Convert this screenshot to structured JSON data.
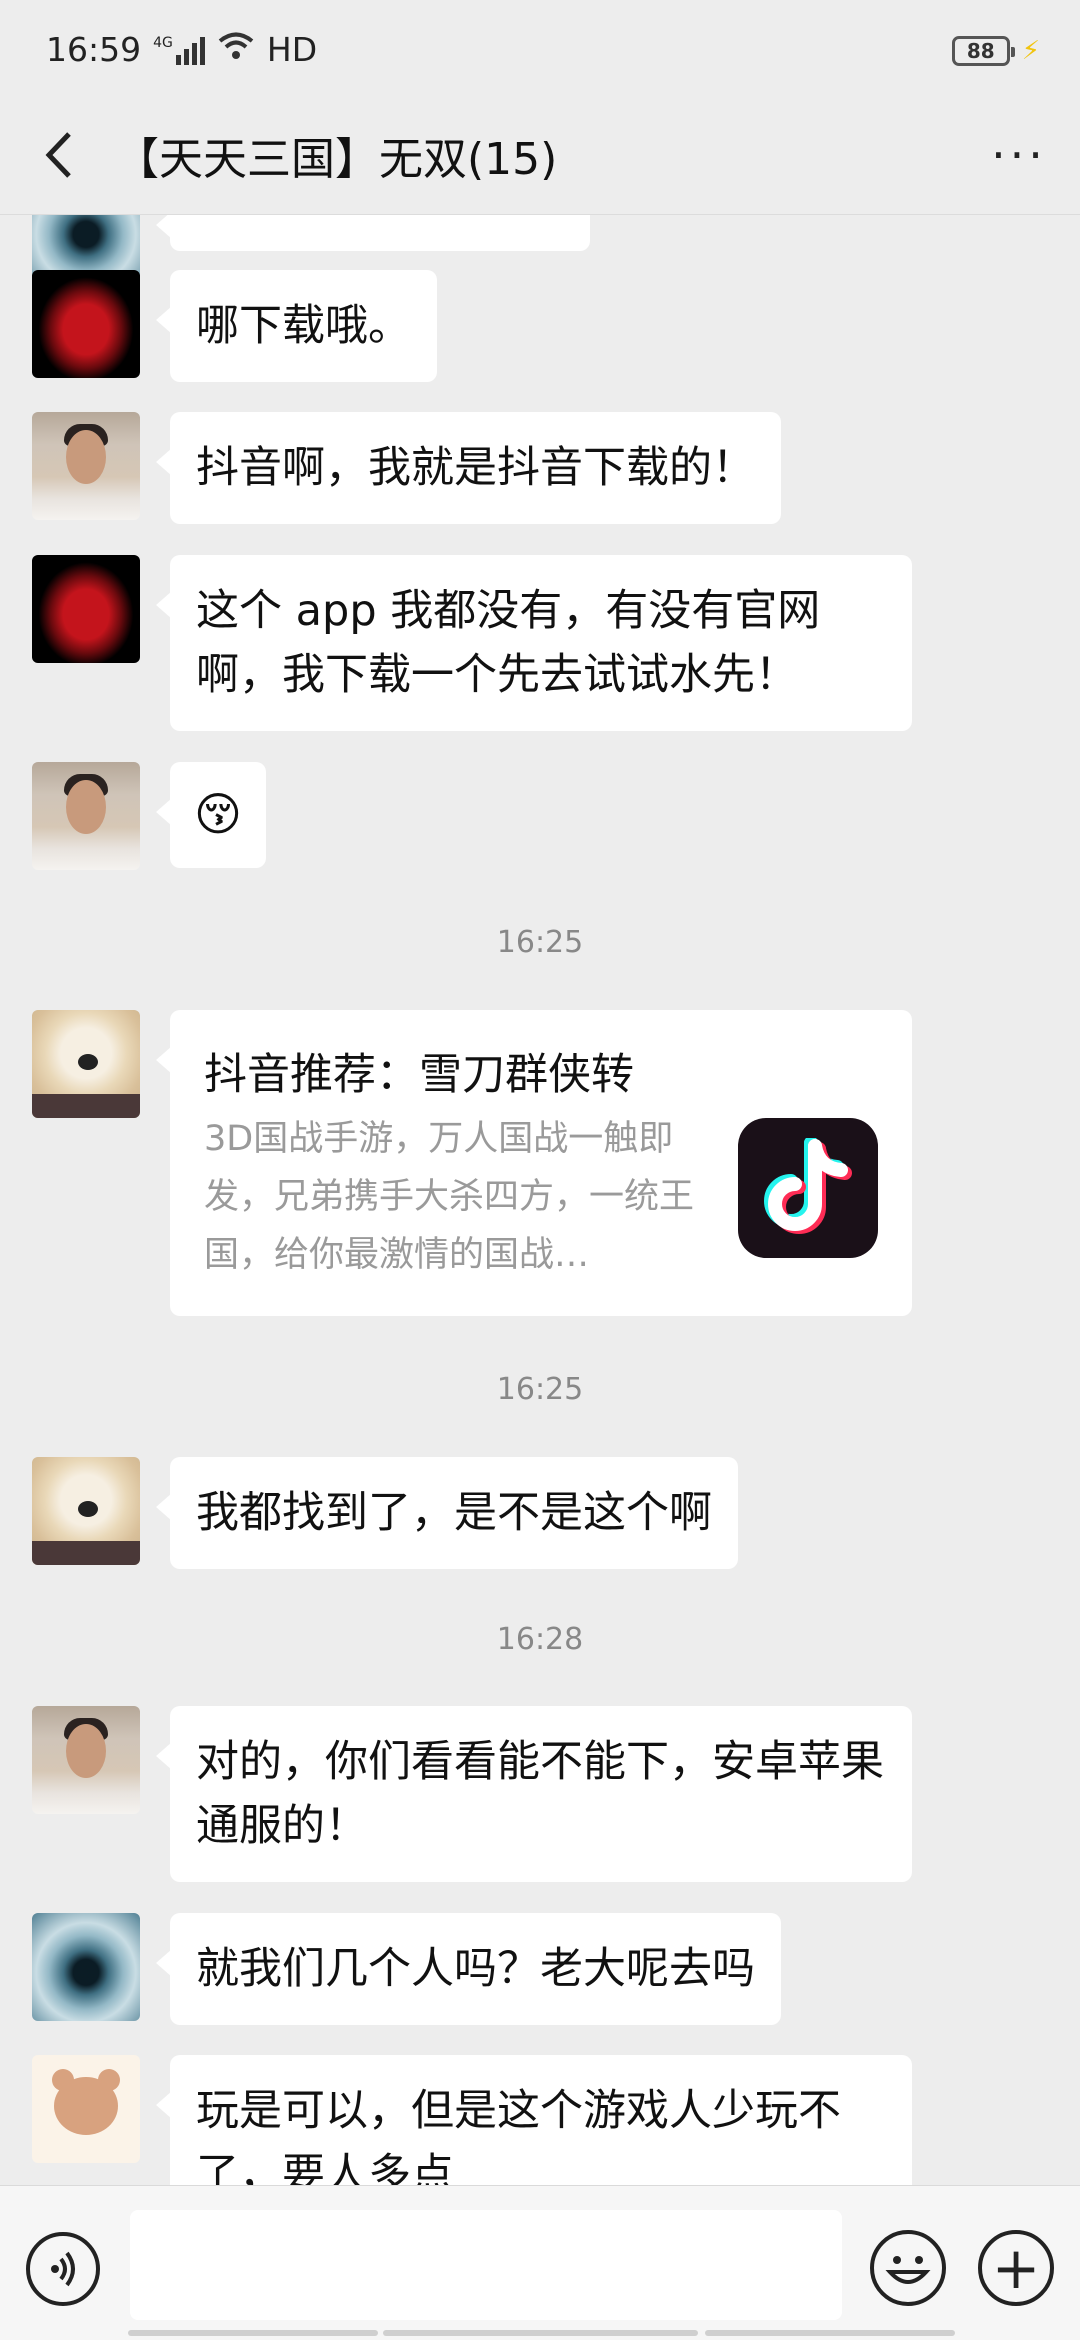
{
  "status_bar": {
    "time": "16:59",
    "network": "4G",
    "hd": "HD",
    "battery": "88"
  },
  "header": {
    "title": "【天天三国】无双(15)"
  },
  "messages": [
    {
      "text": "哪下载哦。"
    },
    {
      "text": "抖音啊，我就是抖音下载的！"
    },
    {
      "text": "这个 app 我都没有，有没有官网啊，我下载一个先去试试水先！"
    },
    {
      "emoji": "😚"
    },
    {
      "time": "16:25"
    },
    {
      "card_title": "抖音推荐：雪刀群侠转",
      "card_desc": "3D国战手游，万人国战一触即发，兄弟携手大杀四方，一统王国，给你最激情的国战…"
    },
    {
      "time": "16:25"
    },
    {
      "text": "我都找到了，是不是这个啊"
    },
    {
      "time": "16:28"
    },
    {
      "text": "对的，你们看看能不能下，安卓苹果通服的！"
    },
    {
      "text": "就我们几个人吗？老大呢去吗"
    },
    {
      "text": "玩是可以，但是这个游戏人少玩不了，要人多点"
    }
  ],
  "icons": [
    "back-arrow-icon",
    "more-icon",
    "voice-icon",
    "emoji-icon",
    "plus-icon",
    "douyin-icon"
  ]
}
